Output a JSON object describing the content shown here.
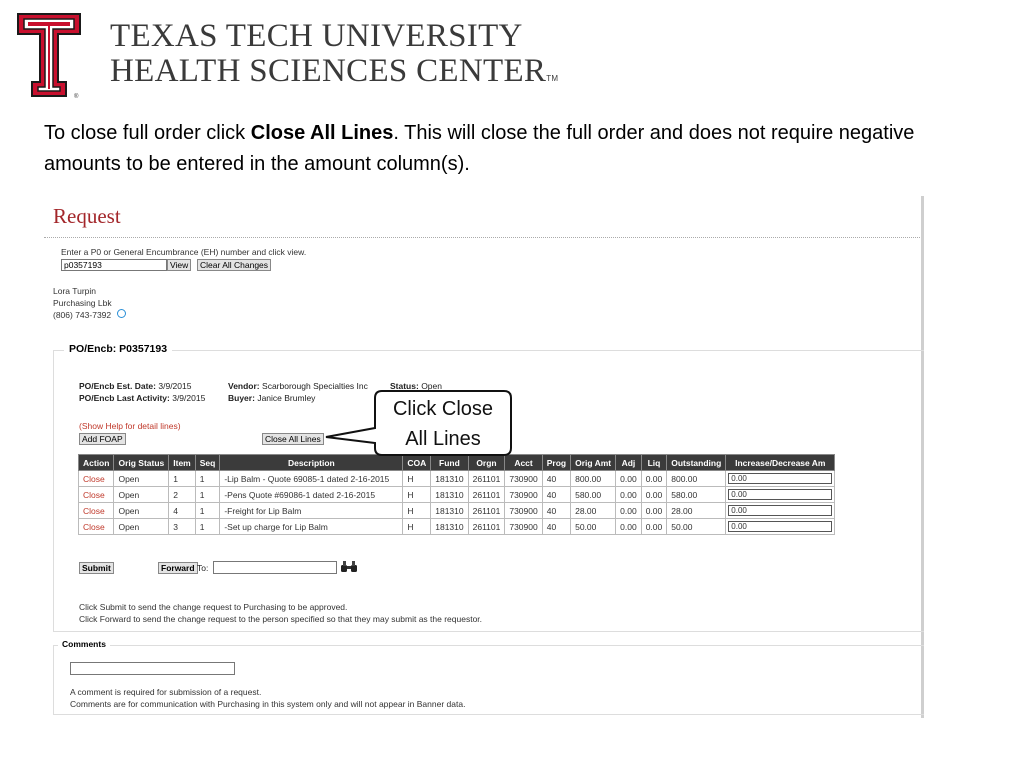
{
  "header": {
    "logo_mark": "TT",
    "logo_registered": "®",
    "title_line1": "TEXAS TECH UNIVERSITY",
    "title_line2": "HEALTH SCIENCES CENTER",
    "trademark": "TM"
  },
  "instruction": {
    "before": "To close full order click ",
    "bold": "Close All Lines",
    "after": ".  This will close the full order and does not require negative amounts to be entered in the amount column(s)."
  },
  "colors": {
    "brand_red": "#c8102e",
    "title_red": "#a3262a",
    "header_dark": "#3b3b3b"
  },
  "request": {
    "title": "Request",
    "prompt": "Enter a P0 or General Encumbrance (EH) number and click view.",
    "po_value": "p0357193",
    "view_label": "View",
    "clear_label": "Clear All Changes",
    "contact": {
      "name": "Lora Turpin",
      "dept": "Purchasing Lbk",
      "phone": "(806) 743-7392"
    },
    "phone_icon": "globe-icon"
  },
  "po": {
    "legend": "PO/Encb:  P0357193",
    "est_date_label": "PO/Encb Est. Date:",
    "est_date": "3/9/2015",
    "last_activity_label": "PO/Encb Last Activity:",
    "last_activity": "3/9/2015",
    "vendor_label": "Vendor:",
    "vendor": "Scarborough Specialties Inc",
    "buyer_label": "Buyer:",
    "buyer": "Janice Brumley",
    "status_label": "Status:",
    "status": "Open",
    "help_link": "(Show Help for detail lines)",
    "add_foap_label": "Add FOAP",
    "close_all_label": "Close All Lines"
  },
  "table": {
    "columns": [
      "Action",
      "Orig Status",
      "Item",
      "Seq",
      "Description",
      "COA",
      "Fund",
      "Orgn",
      "Acct",
      "Prog",
      "Orig Amt",
      "Adj",
      "Liq",
      "Outstanding",
      "Increase/Decrease Am"
    ],
    "rows": [
      [
        "Close",
        "Open",
        "1",
        "1",
        "-Lip Balm - Quote 69085-1 dated 2-16-2015",
        "H",
        "181310",
        "261101",
        "730900",
        "40",
        "800.00",
        "0.00",
        "0.00",
        "800.00",
        "0.00"
      ],
      [
        "Close",
        "Open",
        "2",
        "1",
        "-Pens Quote #69086-1 dated 2-16-2015",
        "H",
        "181310",
        "261101",
        "730900",
        "40",
        "580.00",
        "0.00",
        "0.00",
        "580.00",
        "0.00"
      ],
      [
        "Close",
        "Open",
        "4",
        "1",
        "-Freight for Lip Balm",
        "H",
        "181310",
        "261101",
        "730900",
        "40",
        "28.00",
        "0.00",
        "0.00",
        "28.00",
        "0.00"
      ],
      [
        "Close",
        "Open",
        "3",
        "1",
        "-Set up charge for Lip Balm",
        "H",
        "181310",
        "261101",
        "730900",
        "40",
        "50.00",
        "0.00",
        "0.00",
        "50.00",
        "0.00"
      ]
    ]
  },
  "actions": {
    "submit_label": "Submit",
    "forward_label": "Forward",
    "to_label": "To:",
    "search_icon": "binoculars-icon",
    "note1": "Click Submit to send the change request to Purchasing to be approved.",
    "note2": "Click Forward to send the change request to the person specified so that they may submit as the requestor."
  },
  "comments": {
    "legend": "Comments",
    "note1": "A comment is required for submission of a request.",
    "note2": "Comments are for communication with Purchasing in this system only and will not appear in Banner data."
  },
  "callout": {
    "line1": "Click Close",
    "line2": "All Lines"
  }
}
